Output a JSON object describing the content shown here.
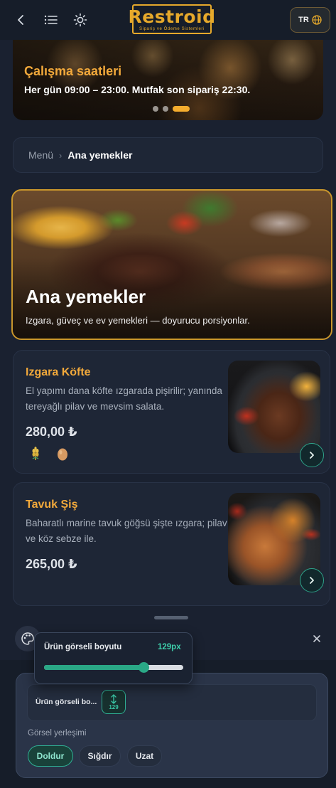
{
  "header": {
    "logo": "Restroid",
    "logo_tagline": "Sipariş ve Ödeme Sistemleri",
    "lang_label": "TR",
    "icons": [
      "back-icon",
      "menu-list-icon",
      "theme-sun-icon",
      "globe-icon"
    ]
  },
  "banner": {
    "title": "Çalışma saatleri",
    "text": "Her gün 09:00 – 23:00. Mutfak son sipariş 22:30.",
    "slides": 3,
    "active_slide": 3
  },
  "breadcrumb": {
    "root": "Menü",
    "current": "Ana yemekler"
  },
  "category": {
    "title": "Ana yemekler",
    "subtitle": "Izgara, güveç ve ev yemekleri — doyurucu porsiyonlar."
  },
  "dishes": [
    {
      "name": "Izgara Köfte",
      "description": "El yapımı dana köfte ızgarada pişirilir; yanında tereyağlı pilav ve mevsim salata.",
      "price": "280,00 ₺",
      "allergens": [
        "wheat-icon",
        "egg-icon"
      ]
    },
    {
      "name": "Tavuk Şiş",
      "description": "Baharatlı marine tavuk göğsü şişte ızgara; pilav ve köz sebze ile.",
      "price": "265,00 ₺",
      "allergens": []
    }
  ],
  "settings_panel": {
    "image_size_label": "Ürün görseli boyutu",
    "image_size_value": "129px",
    "image_size_number": "129",
    "slider_fraction": 0.72,
    "image_size_row_label": "Ürün görseli bo...",
    "placement_label": "Görsel yerleşimi",
    "placement_options": [
      "Doldur",
      "Sığdır",
      "Uzat"
    ],
    "placement_selected": "Doldur"
  },
  "colors": {
    "accent": "#f2a93b",
    "teal": "#2fae93",
    "background": "#1a2130",
    "card": "#1e2636"
  }
}
